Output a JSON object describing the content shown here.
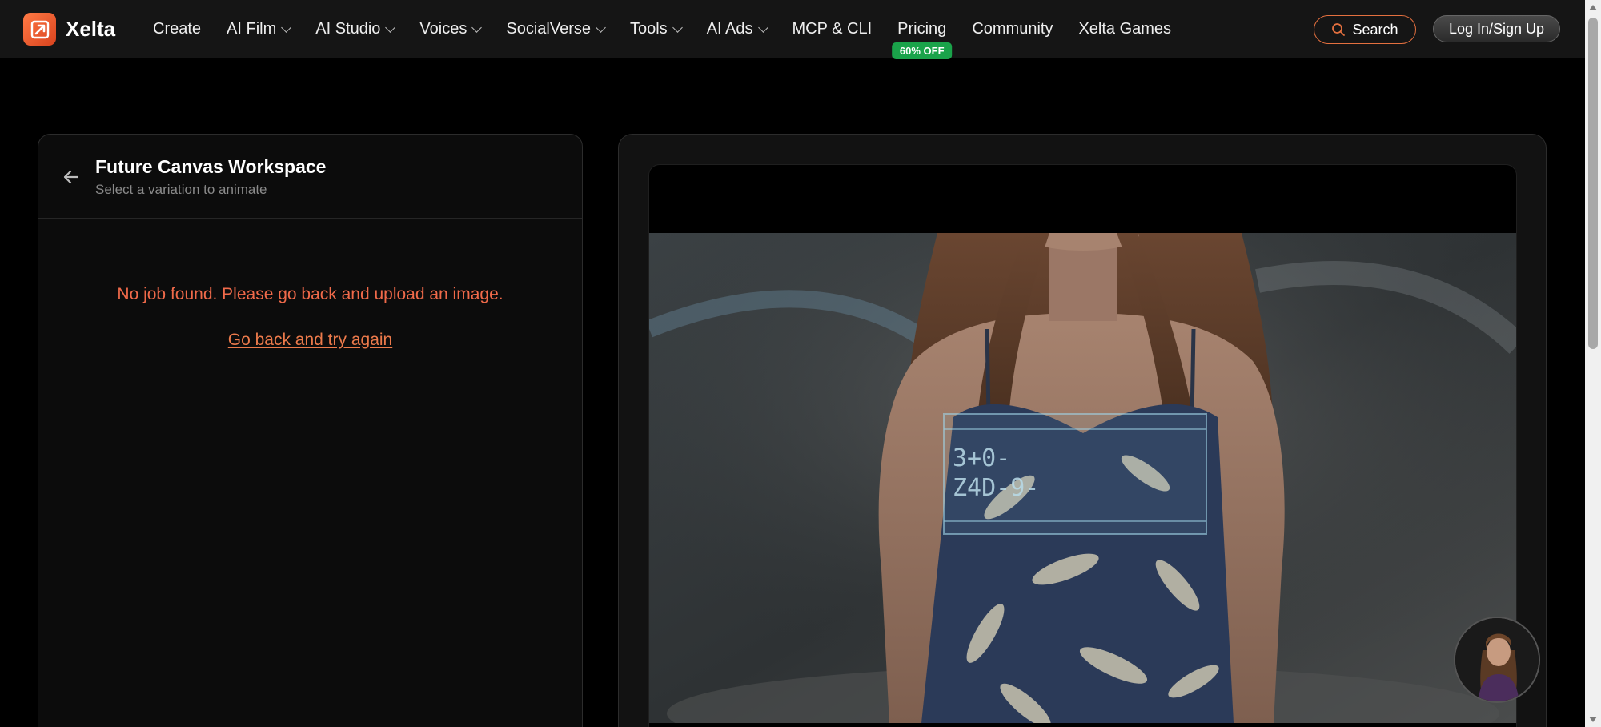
{
  "brand": {
    "name": "Xelta"
  },
  "nav": {
    "items": [
      {
        "label": "Create",
        "dropdown": false
      },
      {
        "label": "AI Film",
        "dropdown": true
      },
      {
        "label": "AI Studio",
        "dropdown": true
      },
      {
        "label": "Voices",
        "dropdown": true
      },
      {
        "label": "SocialVerse",
        "dropdown": true
      },
      {
        "label": "Tools",
        "dropdown": true
      },
      {
        "label": "AI Ads",
        "dropdown": true
      },
      {
        "label": "MCP & CLI",
        "dropdown": false
      },
      {
        "label": "Pricing",
        "dropdown": false
      },
      {
        "label": "Community",
        "dropdown": false
      },
      {
        "label": "Xelta Games",
        "dropdown": false
      }
    ],
    "pricing_badge": "60% OFF",
    "search_label": "Search",
    "login_label": "Log In/Sign Up"
  },
  "workspace": {
    "title": "Future Canvas Workspace",
    "subtitle": "Select a variation to animate",
    "error_message": "No job found. Please go back and upload an image.",
    "retry_link": "Go back and try again"
  },
  "preview": {
    "overlay_text_1": "3+0-",
    "overlay_text_2": "Z4D-9-"
  },
  "colors": {
    "accent": "#ec7a4b",
    "error": "#f06a4a",
    "badge_green": "#1aa34a",
    "background": "#000000",
    "panel": "#0c0c0c"
  }
}
